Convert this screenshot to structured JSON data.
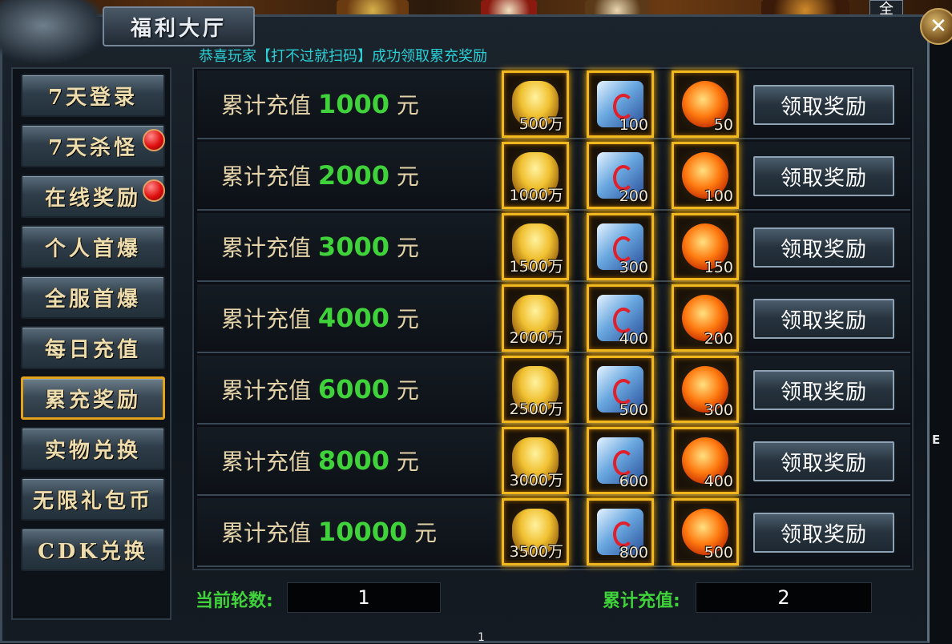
{
  "window": {
    "title": "福利大厅",
    "close_icon": "close-icon",
    "top_tag": "全"
  },
  "announcement": "恭喜玩家【打不过就扫码】成功领取累充奖励",
  "sidebar": {
    "items": [
      {
        "label": "7天登录",
        "red_dot": false,
        "active": false
      },
      {
        "label": "7天杀怪",
        "red_dot": true,
        "active": false
      },
      {
        "label": "在线奖励",
        "red_dot": true,
        "active": false
      },
      {
        "label": "个人首爆",
        "red_dot": false,
        "active": false
      },
      {
        "label": "全服首爆",
        "red_dot": false,
        "active": false
      },
      {
        "label": "每日充值",
        "red_dot": false,
        "active": false
      },
      {
        "label": "累充奖励",
        "red_dot": false,
        "active": true
      },
      {
        "label": "实物兑换",
        "red_dot": false,
        "active": false
      },
      {
        "label": "无限礼包币",
        "red_dot": false,
        "active": false
      },
      {
        "label": "CDK兑换",
        "red_dot": false,
        "active": false
      }
    ]
  },
  "rewards": {
    "label_prefix": "累计充值",
    "unit": "元",
    "claim_label": "领取奖励",
    "rows": [
      {
        "amount": "1000",
        "items": [
          "500万",
          "100",
          "50"
        ]
      },
      {
        "amount": "2000",
        "items": [
          "1000万",
          "200",
          "100"
        ]
      },
      {
        "amount": "3000",
        "items": [
          "1500万",
          "300",
          "150"
        ]
      },
      {
        "amount": "4000",
        "items": [
          "2000万",
          "400",
          "200"
        ]
      },
      {
        "amount": "6000",
        "items": [
          "2500万",
          "500",
          "300"
        ]
      },
      {
        "amount": "8000",
        "items": [
          "3000万",
          "600",
          "400"
        ]
      },
      {
        "amount": "10000",
        "items": [
          "3500万",
          "800",
          "500"
        ]
      }
    ],
    "item_icons": [
      "gold-ingot-icon",
      "crystal-gem-icon",
      "fire-orb-icon"
    ]
  },
  "footer": {
    "round_label": "当前轮数:",
    "round_value": "1",
    "total_label": "累计充值:",
    "total_value": "2"
  },
  "misc": {
    "side_letter": "E",
    "bottom_number": "1"
  },
  "colors": {
    "accent_green": "#3fd23a",
    "announce_cyan": "#29d0d6",
    "gold_border": "#f0b820"
  }
}
